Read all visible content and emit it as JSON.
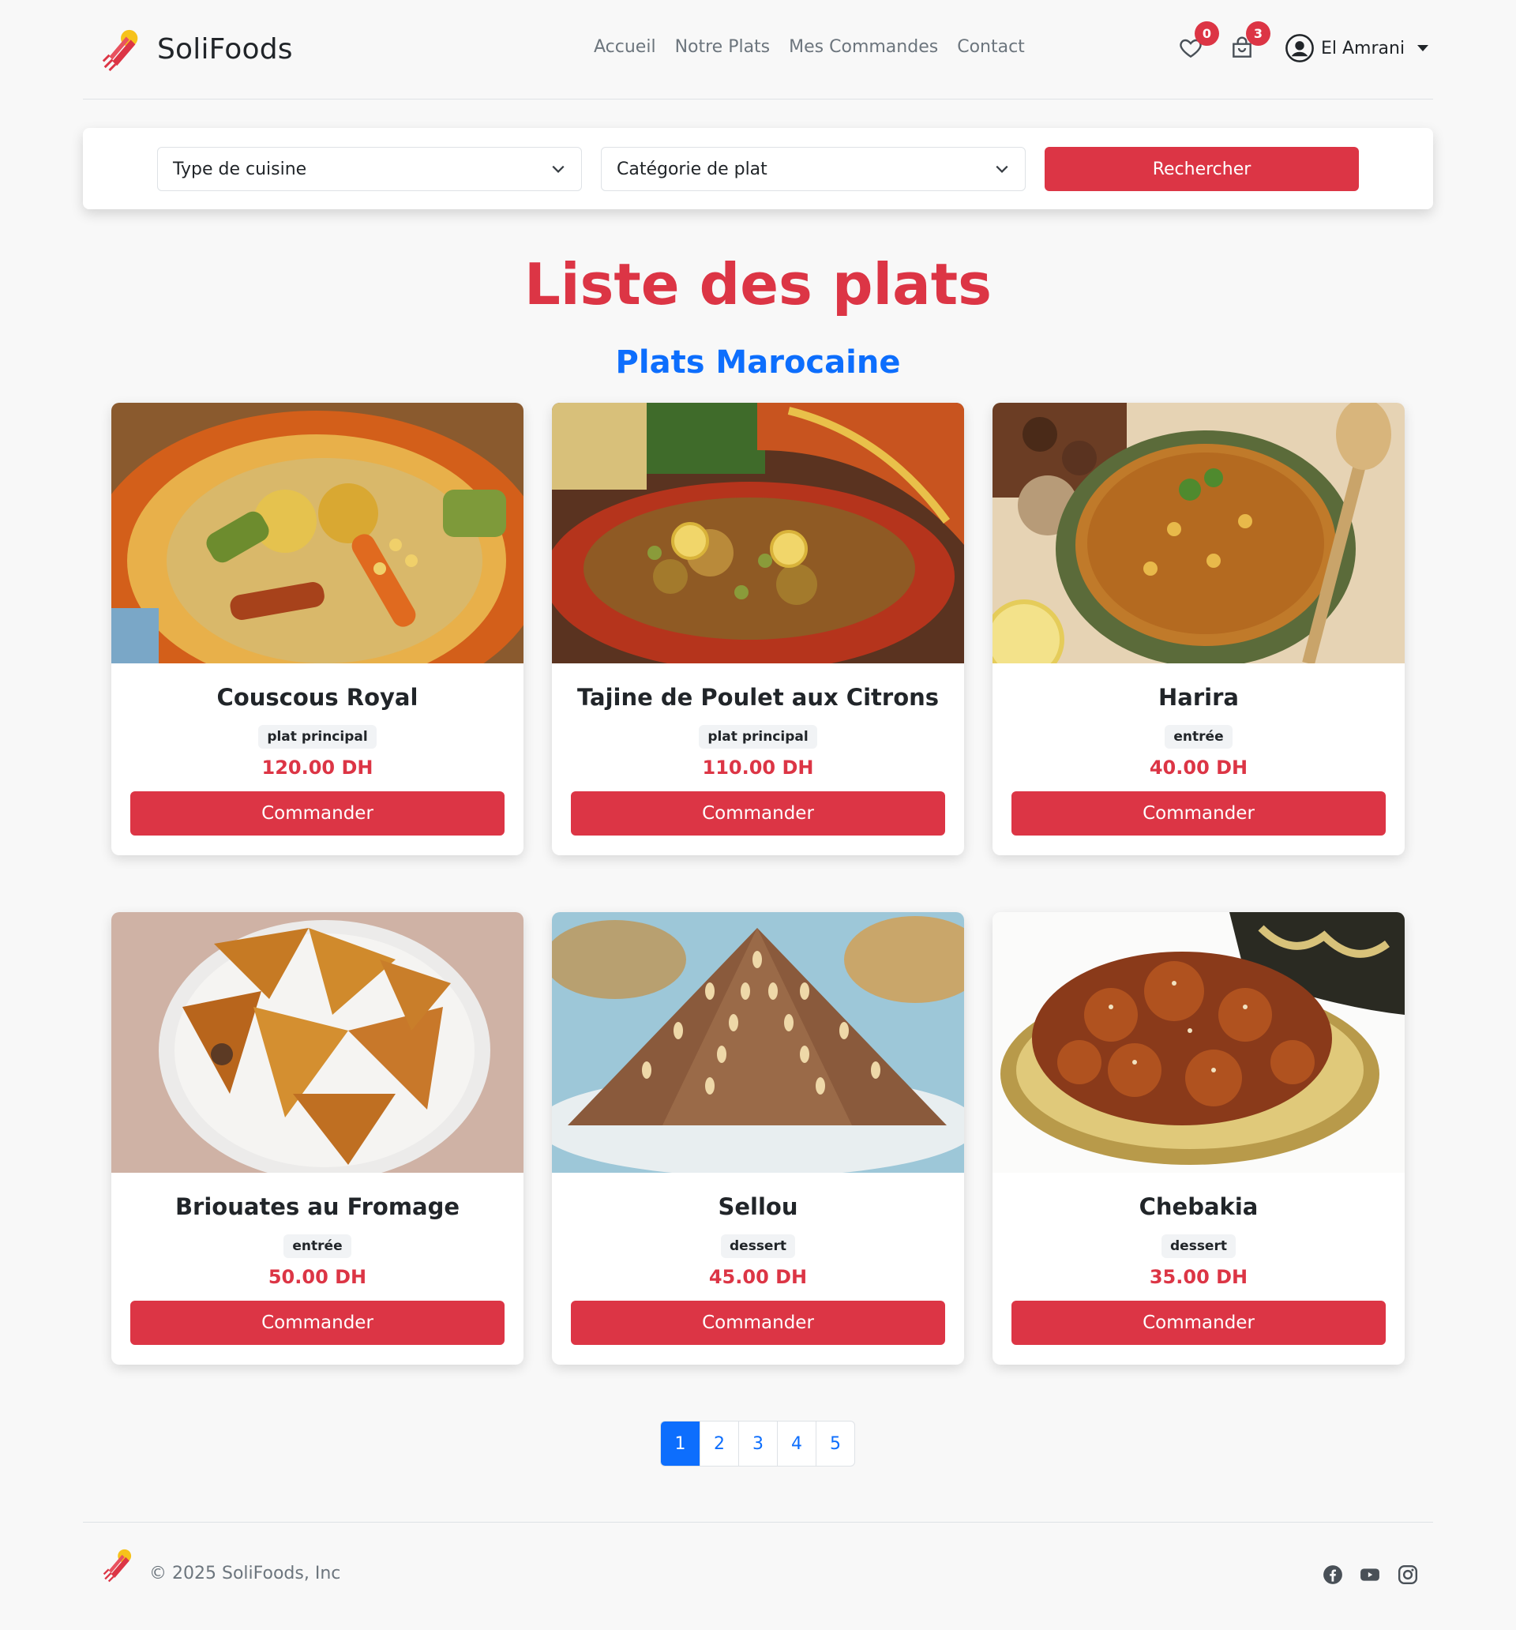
{
  "brand": {
    "name": "SoliFoods"
  },
  "nav": {
    "items": [
      "Accueil",
      "Notre Plats",
      "Mes Commandes",
      "Contact"
    ]
  },
  "header": {
    "favorites_count": "0",
    "cart_count": "3",
    "user_name": "El Amrani"
  },
  "search": {
    "cuisine_select": "Type de cuisine",
    "category_select": "Catégorie de plat",
    "button": "Rechercher"
  },
  "page_title": "Liste des plats",
  "section_title": "Plats Marocaine",
  "dishes": [
    {
      "name": "Couscous Royal",
      "category": "plat principal",
      "price": "120.00 DH",
      "button": "Commander"
    },
    {
      "name": "Tajine de Poulet aux Citrons",
      "category": "plat principal",
      "price": "110.00 DH",
      "button": "Commander"
    },
    {
      "name": "Harira",
      "category": "entrée",
      "price": "40.00 DH",
      "button": "Commander"
    },
    {
      "name": "Briouates au Fromage",
      "category": "entrée",
      "price": "50.00 DH",
      "button": "Commander"
    },
    {
      "name": "Sellou",
      "category": "dessert",
      "price": "45.00 DH",
      "button": "Commander"
    },
    {
      "name": "Chebakia",
      "category": "dessert",
      "price": "35.00 DH",
      "button": "Commander"
    }
  ],
  "pagination": {
    "pages": [
      "1",
      "2",
      "3",
      "4",
      "5"
    ],
    "active": "1"
  },
  "footer": {
    "copyright": "© 2025 SoliFoods, Inc"
  },
  "colors": {
    "primary_red": "#dc3545",
    "primary_blue": "#0d6efd"
  }
}
